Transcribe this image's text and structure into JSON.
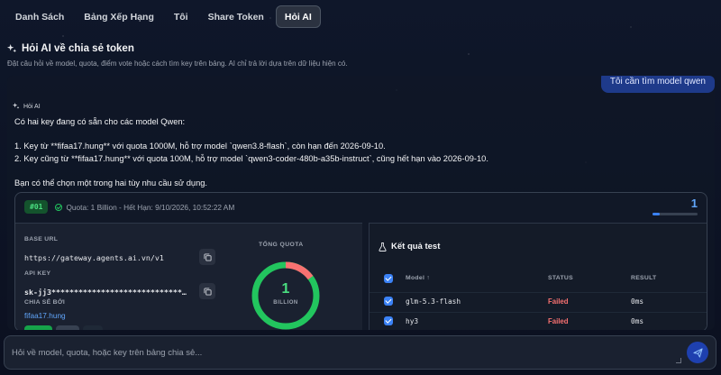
{
  "nav": {
    "tabs": [
      {
        "label": "Danh Sách"
      },
      {
        "label": "Bảng Xếp Hạng"
      },
      {
        "label": "Tôi"
      },
      {
        "label": "Share Token"
      },
      {
        "label": "Hỏi AI"
      }
    ],
    "active_index": 4
  },
  "header": {
    "title": "Hỏi AI về chia sẻ token",
    "subtitle": "Đặt câu hỏi về model, quota, điểm vote hoặc cách tìm key trên bảng. AI chỉ trả lời dựa trên dữ liệu hiện có."
  },
  "chat": {
    "user_message": "Tôi cần tìm model qwen",
    "ai_label": "Hỏi AI",
    "ai_lines": [
      "Có hai key đang có sẵn cho các model Qwen:",
      "",
      "1. Key từ **fifaa17.hung** với quota 1000M, hỗ trợ model `qwen3.8-flash`, còn hạn đến 2026-09-10.",
      "2. Key cũng từ **fifaa17.hung** với quota 100M, hỗ trợ model `qwen3-coder-480b-a35b-instruct`, cũng hết hạn vào 2026-09-10.",
      "",
      "Bạn có thể chọn một trong hai tùy nhu cầu sử dụng."
    ]
  },
  "card": {
    "badge": "#01",
    "quota_line": "Quota: 1 Billion - Hết Hạn: 9/10/2026, 10:52:22 AM",
    "corner_number": "1",
    "progress_fraction": 0.15,
    "base_url_label": "BASE URL",
    "base_url": "https://gateway.agents.ai.vn/v1",
    "api_key_label": "API KEY",
    "api_key": "sk-jj3*****************************…",
    "shared_by_label": "CHIA SẺ BỞI",
    "shared_by": "fifaa17.hung",
    "total_quota_label": "TỔNG QUOTA",
    "total_quota_value": "1",
    "total_quota_unit": "BILLION",
    "quota_used_fraction": 0.15,
    "colors": {
      "green": "#22c55e",
      "red": "#f87171",
      "blue": "#3b82f6"
    }
  },
  "test_results": {
    "title": "Kết quả test",
    "columns": {
      "model": "Model ↑",
      "status": "STATUS",
      "result": "RESULT"
    },
    "rows": [
      {
        "model": "glm-5.3-flash",
        "status": "Failed",
        "result": "0ms"
      },
      {
        "model": "hy3",
        "status": "Failed",
        "result": "0ms"
      }
    ]
  },
  "input": {
    "placeholder": "Hỏi về model, quota, hoặc key trên bảng chia sẻ..."
  },
  "icons": {
    "header": "sparkles-icon",
    "ai": "sparkles-icon",
    "copy": "copy-icon",
    "results": "flask-icon",
    "send": "send-icon"
  }
}
